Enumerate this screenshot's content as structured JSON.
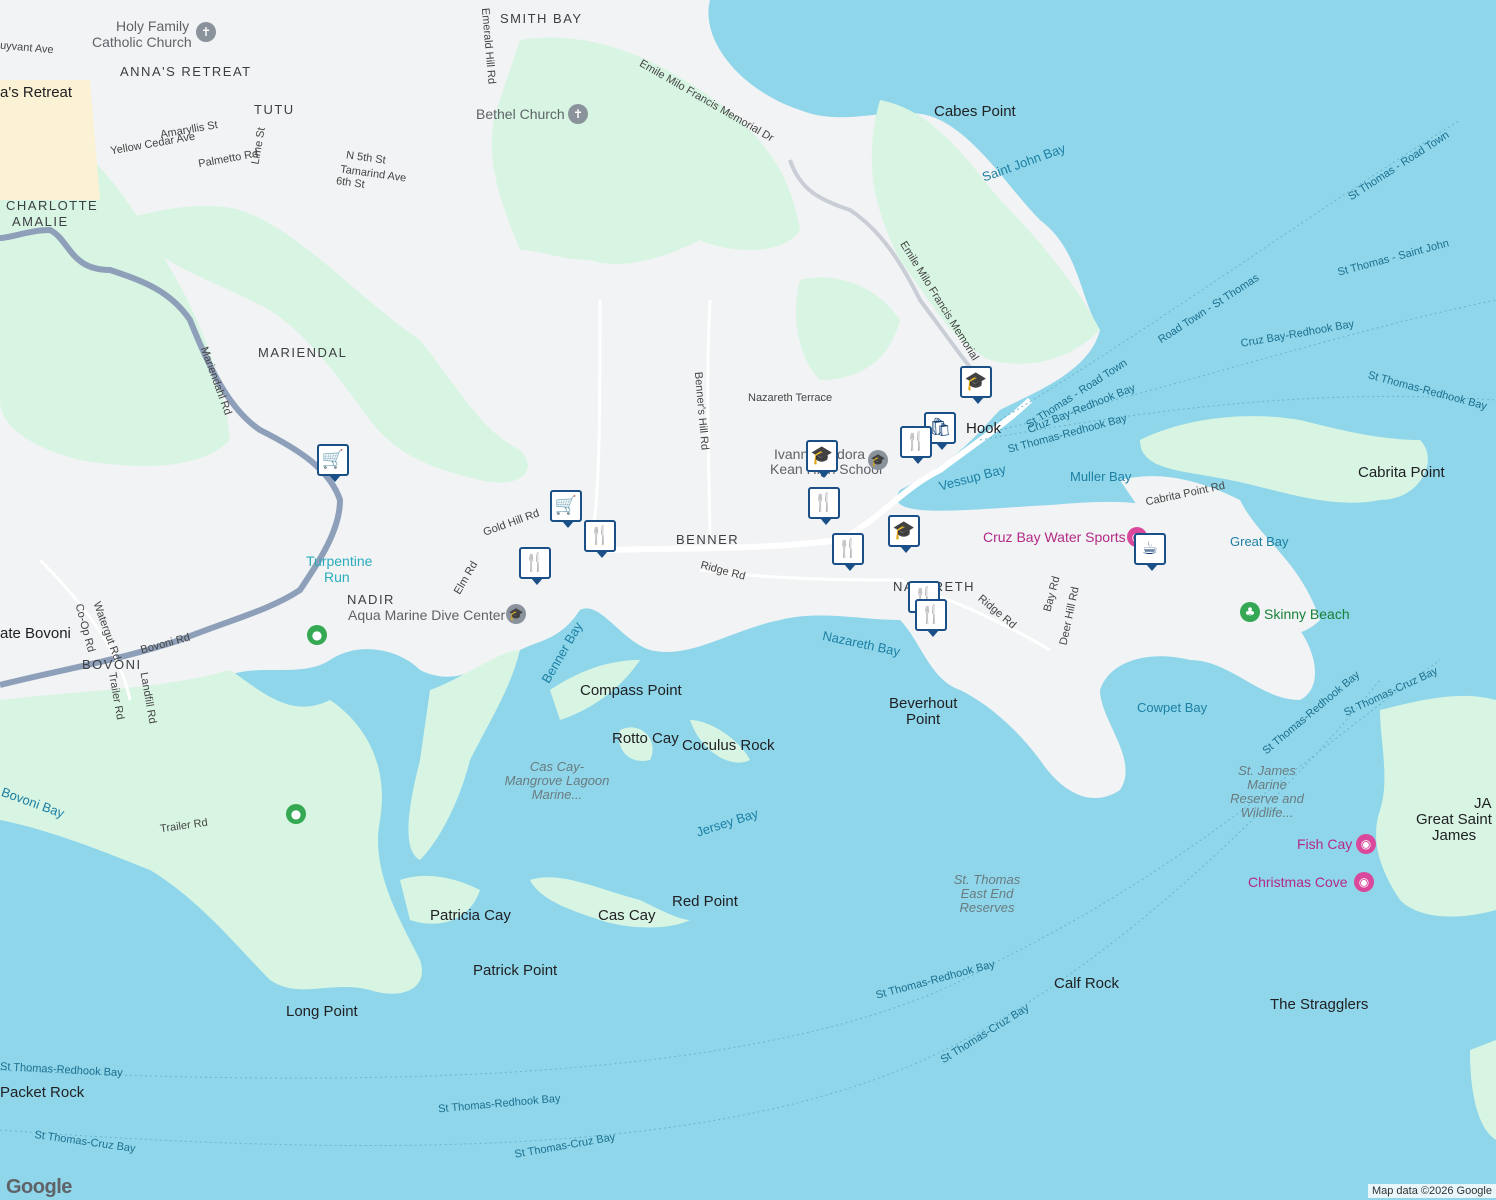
{
  "colors": {
    "water": "#8fd6ea",
    "land": "#f1f3f4",
    "park": "#d8f5e3",
    "highway": "#8e9fb9",
    "marker_border": "#1a4f88"
  },
  "places": {
    "charlotte_amalie_1": "CHARLOTTE",
    "charlotte_amalie_2": "AMALIE",
    "annas_retreat": "ANNA'S RETREAT",
    "annas_retreat_town": "a's Retreat",
    "tutu": "TUTU",
    "smith_bay": "SMITH BAY",
    "mariendal": "MARIENDAL",
    "nadir": "NADIR",
    "bovoni": "BOVONI",
    "estate_bovoni": "ate Bovoni",
    "benner": "BENNER",
    "nazareth": "NAZARETH",
    "red_hook": "Hook"
  },
  "features": {
    "cabes_point": "Cabes Point",
    "compass_point": "Compass Point",
    "rotto_cay": "Rotto Cay",
    "coculus_rock": "Coculus Rock",
    "beverhout_point_1": "Beverhout",
    "beverhout_point_2": "Point",
    "patricia_cay": "Patricia Cay",
    "cas_cay": "Cas Cay",
    "red_point": "Red Point",
    "patrick_point": "Patrick Point",
    "long_point": "Long Point",
    "packet_rock": "Packet Rock",
    "calf_rock": "Calf Rock",
    "the_stragglers": "The Stragglers",
    "cabrita_point": "Cabrita Point",
    "great_st_james_1": "Great Saint",
    "great_st_james_2": "James",
    "great_st_james_edge": "JA"
  },
  "water": {
    "saint_john_bay": "Saint John Bay",
    "vessup_bay": "Vessup Bay",
    "muller_bay": "Muller Bay",
    "great_bay": "Great Bay",
    "cowpet_bay": "Cowpet Bay",
    "nazareth_bay": "Nazareth Bay",
    "benner_bay": "Benner Bay",
    "jersey_bay": "Jersey Bay",
    "bovoni_bay": "Bovoni Bay"
  },
  "roads": {
    "emile_1": "Emile Milo Francis Memorial Dr",
    "emile_2": "Emile Milo Francis Memorial",
    "mariendahl": "Mariendahl Rd",
    "bovoni_rd": "Bovoni Rd",
    "benners_hill": "Benner's Hill Rd",
    "nazareth_terrace": "Nazareth Terrace",
    "ridge_rd_1": "Ridge Rd",
    "ridge_rd_2": "Ridge Rd",
    "gold_hill": "Gold Hill Rd",
    "elm_rd": "Elm Rd",
    "cabrita_point_rd": "Cabrita Point Rd",
    "bay_rd": "Bay Rd",
    "deer_hill": "Deer Hill Rd",
    "watergut": "Watergut Rd",
    "co_op": "Co-Op Rd",
    "trailer_rd_1": "Trailer Rd",
    "trailer_rd_2": "Trailer Rd",
    "landfill": "Landfill Rd",
    "amaryllis": "Amaryllis St",
    "yellow_cedar": "Yellow Cedar Ave",
    "palmetto": "Palmetto Rd",
    "lime": "Lime St",
    "n5th": "N 5th St",
    "tamarind": "Tamarind Ave",
    "sixth": "6th St",
    "emerald_hill": "Emerald Hill Rd",
    "stuyvesant": "uyvant Ave"
  },
  "ferries": {
    "f1": "St Thomas - Road Town",
    "f2": "St Thomas - Saint John",
    "f3": "Road Town - St Thomas",
    "f4": "Cruz Bay-Redhook Bay",
    "f5": "St Thomas-Redhook Bay",
    "f6": "St Thomas - Road Town",
    "f7": "Cruz Bay-Redhook Bay",
    "f8": "St Thomas-Redhook Bay",
    "f9": "St Thomas-Redhook Bay",
    "f10": "St Thomas-Cruz Bay",
    "f11": "St Thomas-Redhook Bay",
    "f12": "St Thomas-Cruz Bay",
    "f13": "St Thomas-Redhook Bay",
    "f14": "St Thomas-Redhook Bay",
    "f15": "St Thomas-Cruz Bay",
    "f16": "St Thomas-Cruz Bay",
    "f17": "St Thomas-Redhook Bay"
  },
  "pois": {
    "holy_family_1": "Holy Family",
    "holy_family_2": "Catholic Church",
    "bethel": "Bethel Church",
    "ivanna_1": "Ivanna Eudora",
    "ivanna_2": "Kean High School",
    "aqua_marine": "Aqua Marine Dive Center",
    "turpentine_1": "Turpentine",
    "turpentine_2": "Run",
    "cruz_bay_ws": "Cruz Bay Water Sports",
    "skinny_beach": "Skinny Beach",
    "fish_cay": "Fish Cay",
    "christmas_cove": "Christmas Cove",
    "cas_cay_mangrove": "Cas Cay-Mangrove Lagoon Marine...",
    "st_thomas_east_end": "St. Thomas East End Reserves",
    "st_james_marine": "St. James Marine Reserve and Wildlife..."
  },
  "markers": [
    {
      "icon": "cart-icon",
      "glyph": "🛒"
    },
    {
      "icon": "cart-icon",
      "glyph": "🛒"
    },
    {
      "icon": "restaurant-icon",
      "glyph": "🍴"
    },
    {
      "icon": "restaurant-icon",
      "glyph": "🍴"
    },
    {
      "icon": "school-icon",
      "glyph": "🎓"
    },
    {
      "icon": "restaurant-icon",
      "glyph": "🍴"
    },
    {
      "icon": "restaurant-icon",
      "glyph": "🍴"
    },
    {
      "icon": "school-icon",
      "glyph": "🎓"
    },
    {
      "icon": "restaurant-icon",
      "glyph": "🍴"
    },
    {
      "icon": "restaurant-icon",
      "glyph": "🍴"
    },
    {
      "icon": "cafe-icon",
      "glyph": "☕"
    },
    {
      "icon": "shopping-bag-icon",
      "glyph": "🛍"
    },
    {
      "icon": "restaurant-icon",
      "glyph": "🍴"
    },
    {
      "icon": "school-icon",
      "glyph": "🎓"
    }
  ],
  "logo": "Google",
  "attribution": "Map data ©2026 Google"
}
